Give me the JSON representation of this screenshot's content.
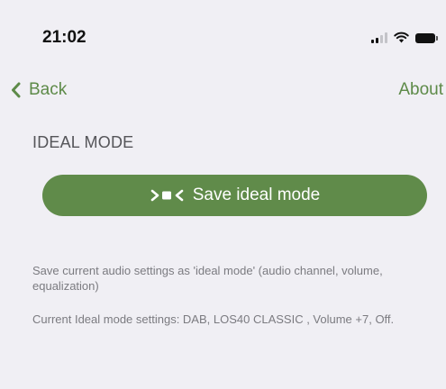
{
  "status_bar": {
    "time": "21:02",
    "icons": [
      "cellular-signal-icon",
      "wifi-icon",
      "battery-icon"
    ]
  },
  "nav": {
    "back_label": "Back",
    "about_label": "About"
  },
  "ideal_mode": {
    "section_title": "IDEAL MODE",
    "save_button_label": "Save ideal mode",
    "save_button_icon": "ideal-mode-icon",
    "description": "Save current audio settings as 'ideal mode' (audio channel, volume, equalization)",
    "current_settings": "Current Ideal mode settings: DAB, LOS40 CLASSIC  , Volume +7, Off."
  },
  "colors": {
    "accent": "#5d8a48",
    "button_bg": "#608b4a",
    "background": "#f0eff4",
    "secondary_text": "#7b7b80"
  }
}
